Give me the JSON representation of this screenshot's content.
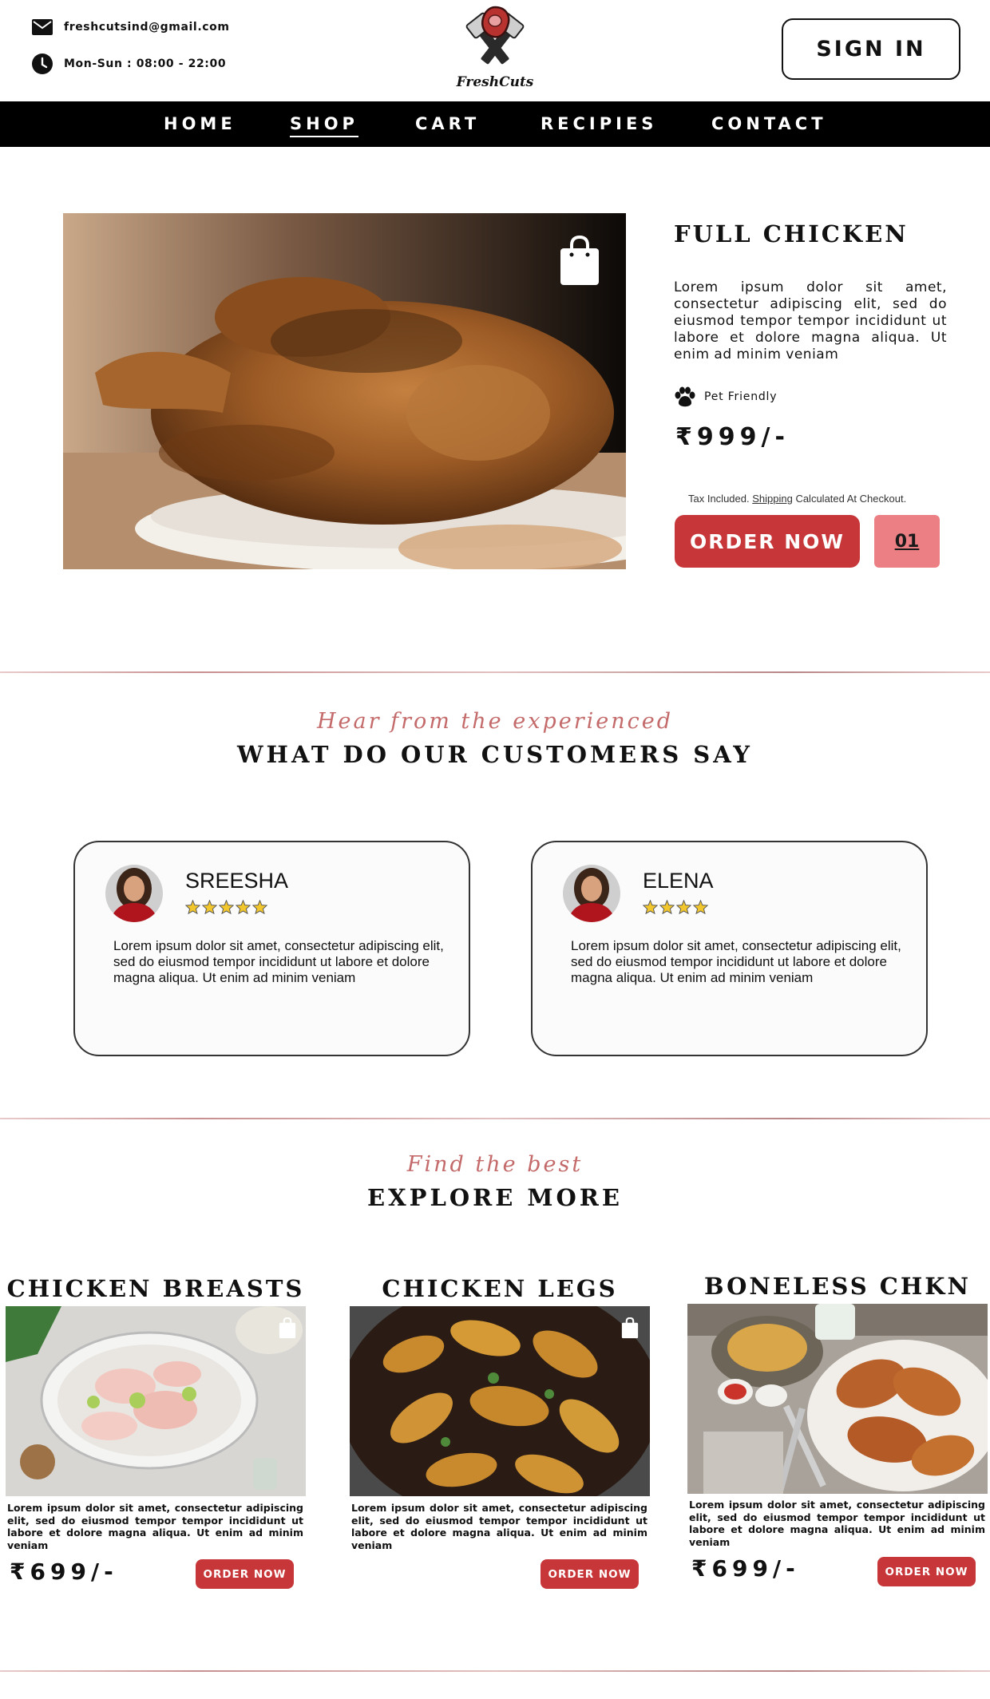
{
  "header": {
    "email": "freshcutsind@gmail.com",
    "hours": "Mon-Sun : 08:00 - 22:00",
    "logo_text": "FreshCuts",
    "sign_in_label": "SIGN IN"
  },
  "nav": {
    "items": [
      {
        "label": "HOME"
      },
      {
        "label": "SHOP",
        "active": true
      },
      {
        "label": "CART"
      },
      {
        "label": "RECIPIES"
      },
      {
        "label": "CONTACT"
      }
    ]
  },
  "product": {
    "title": "FULL CHICKEN",
    "description": "Lorem ipsum dolor sit amet, consectetur adipiscing elit, sed do eiusmod tempor tempor incididunt ut labore et dolore magna aliqua. Ut enim ad minim veniam",
    "badge": "Pet Friendly",
    "price": "₹999/-",
    "tax_prefix": "Tax Included. ",
    "tax_link": "Shipping",
    "tax_suffix": " Calculated At Checkout.",
    "order_label": "ORDER NOW",
    "quantity": "01"
  },
  "testimonials": {
    "subtitle": "Hear from the experienced",
    "title": "WHAT DO OUR CUSTOMERS SAY",
    "reviews": [
      {
        "name": "SREESHA",
        "rating": 5,
        "text": "Lorem ipsum dolor sit amet, consectetur adipiscing elit, sed do eiusmod tempor incididunt ut labore et dolore magna aliqua. Ut enim ad minim veniam"
      },
      {
        "name": "ELENA",
        "rating": 4,
        "text": "Lorem ipsum dolor sit amet, consectetur adipiscing elit, sed do eiusmod tempor incididunt ut labore et dolore magna aliqua. Ut enim ad minim veniam"
      }
    ]
  },
  "explore": {
    "subtitle": "Find the best",
    "title": "EXPLORE MORE",
    "cards": [
      {
        "title": "CHICKEN BREASTS",
        "description": "Lorem ipsum dolor sit amet, consectetur adipiscing elit, sed do eiusmod tempor tempor incididunt ut labore et dolore magna aliqua. Ut enim ad minim veniam",
        "price": "₹699/-",
        "button": "ORDER NOW"
      },
      {
        "title": "CHICKEN LEGS",
        "description": "Lorem ipsum dolor sit amet, consectetur adipiscing elit, sed do eiusmod tempor tempor incididunt ut labore et dolore magna aliqua. Ut enim ad minim veniam",
        "price": "",
        "button": "ORDER NOW"
      },
      {
        "title": "BONELESS CHKN",
        "description": "Lorem ipsum dolor sit amet, consectetur adipiscing elit, sed do eiusmod tempor tempor incididunt ut labore et dolore magna aliqua. Ut enim ad minim veniam",
        "price": "₹699/-",
        "button": "ORDER NOW"
      }
    ]
  },
  "colors": {
    "accent_red": "#c7373a",
    "qty_pink": "#ec7f83",
    "script_rose": "#c46a6a",
    "star_gold": "#f2c62d",
    "nav_bg": "#000000"
  },
  "icons": [
    "mail-icon",
    "clock-icon",
    "shopping-bag-icon",
    "paw-icon",
    "star-icon"
  ]
}
